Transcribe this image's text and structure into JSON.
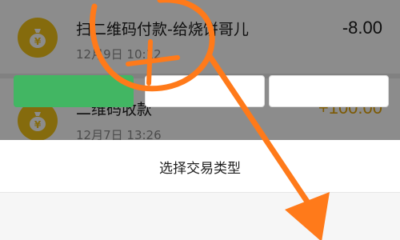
{
  "transactions": [
    {
      "title": "扫二维码付款-给烧饼哥儿",
      "time": "12月9日 10:12",
      "amount": "-8.00",
      "icon": "money-bag-icon"
    },
    {
      "title": "二维码收款",
      "time": "12月7日 13:26",
      "amount": "+100.00",
      "icon": "money-bag-icon"
    }
  ],
  "sheet": {
    "title": "选择交易类型",
    "options": [
      {
        "label": "",
        "selected": true
      },
      {
        "label": "",
        "selected": false
      },
      {
        "label": "",
        "selected": false
      }
    ]
  },
  "colors": {
    "coin": "#f3c418",
    "income": "#e3a406",
    "selected": "#42b663",
    "annotation": "#ff7a1a"
  }
}
